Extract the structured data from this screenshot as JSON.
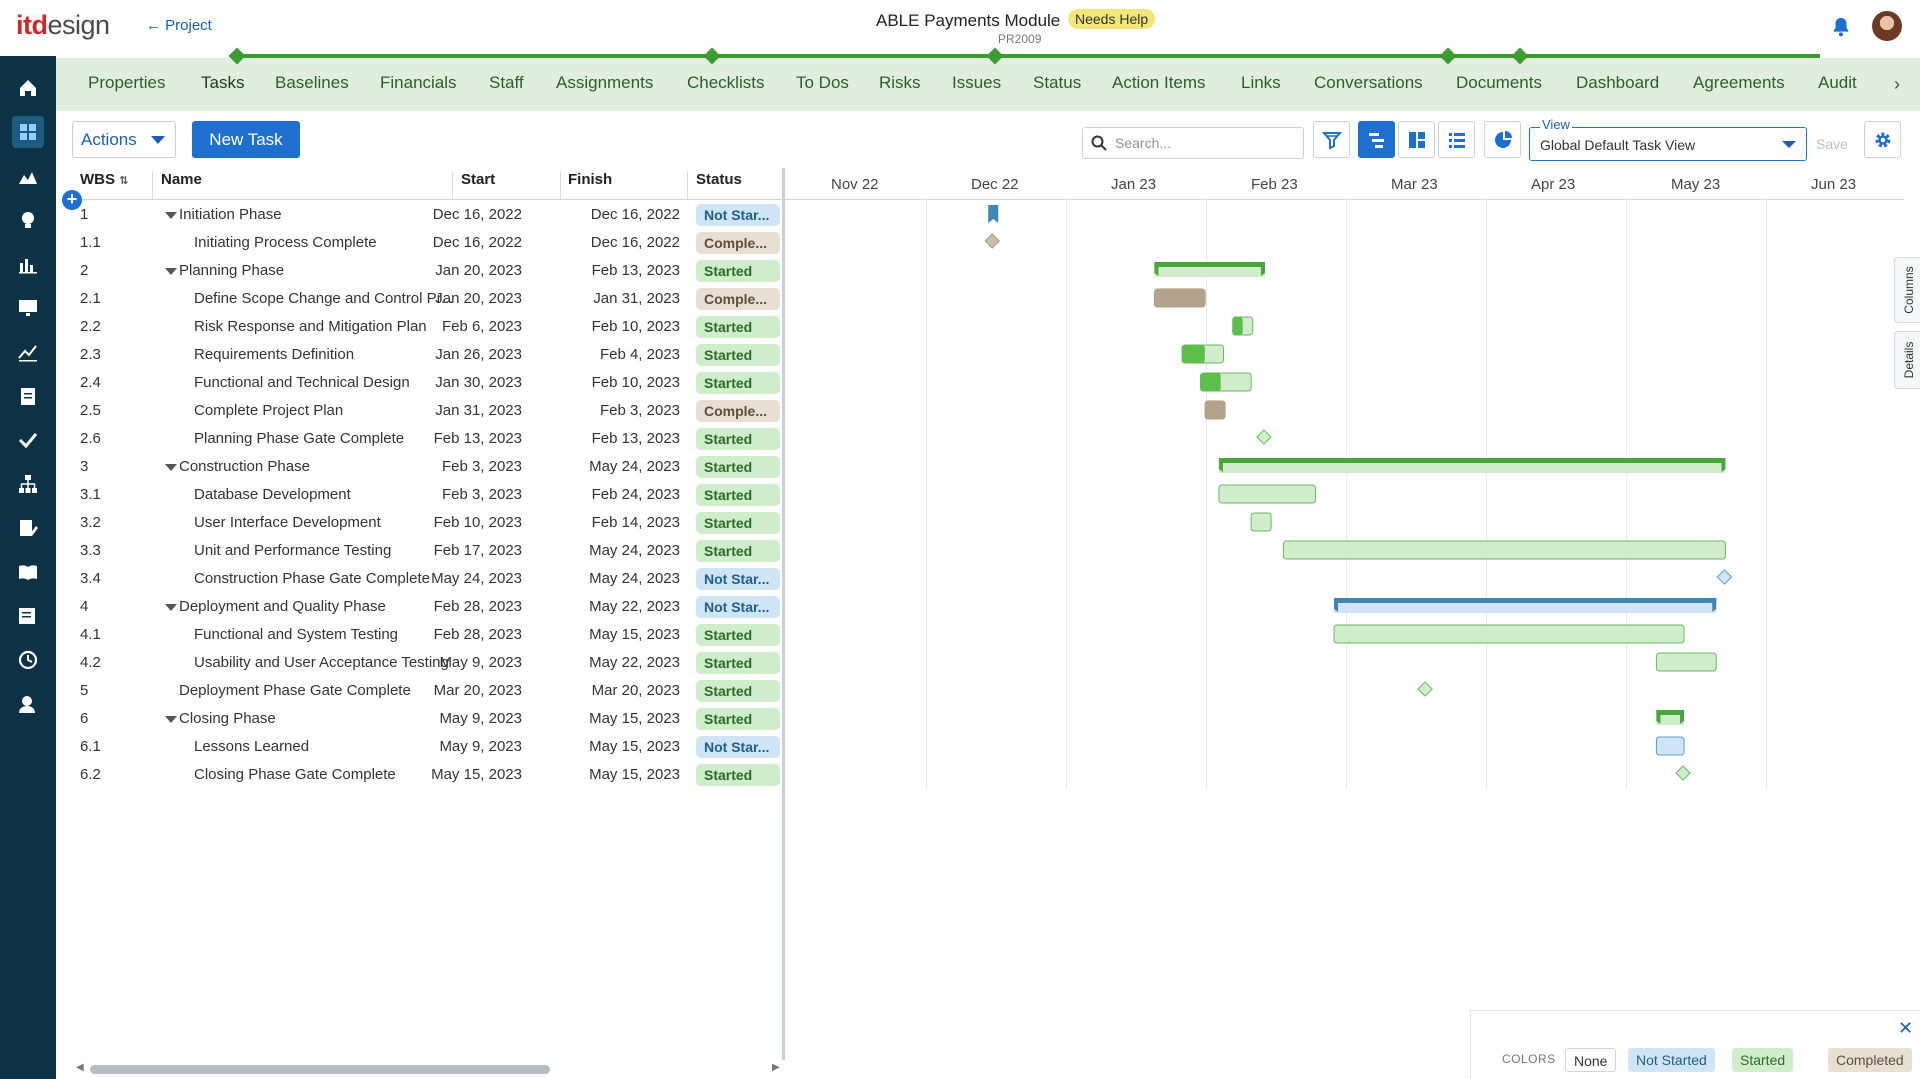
{
  "header": {
    "logo_a": "itd",
    "logo_b": "esign",
    "back_label": "← Project",
    "project_title": "ABLE Payments Module",
    "project_badge": "Needs Help",
    "project_code": "PR2009"
  },
  "sidebar": {
    "items": [
      "home-icon",
      "grid-icon",
      "chart-area-icon",
      "lightbulb-icon",
      "bar-chart-icon",
      "monitor-icon",
      "line-chart-icon",
      "clipboard-icon",
      "check-icon",
      "org-chart-icon",
      "document-edit-icon",
      "book-icon",
      "list-edit-icon",
      "clock-icon",
      "user-gear-icon"
    ]
  },
  "tabs": [
    "Properties",
    "Tasks",
    "Baselines",
    "Financials",
    "Staff",
    "Assignments",
    "Checklists",
    "To Dos",
    "Risks",
    "Issues",
    "Status",
    "Action Items",
    "Links",
    "Conversations",
    "Documents",
    "Dashboard",
    "Agreements",
    "Audit"
  ],
  "active_tab": "Tasks",
  "toolbar": {
    "actions_label": "Actions",
    "new_task_label": "New Task",
    "search_placeholder": "Search...",
    "view_label": "View",
    "view_value": "Global Default Task View",
    "save_label": "Save"
  },
  "columns": {
    "wbs": "WBS",
    "name": "Name",
    "start": "Start",
    "finish": "Finish",
    "status": "Status"
  },
  "months": [
    "Nov 22",
    "Dec 22",
    "Jan 23",
    "Feb 23",
    "Mar 23",
    "Apr 23",
    "May 23",
    "Jun 23"
  ],
  "tasks": [
    {
      "wbs": "1",
      "name": "Initiation Phase",
      "level": 0,
      "toggle": true,
      "start": "Dec 16, 2022",
      "finish": "Dec 16, 2022",
      "status": "Not Star...",
      "status_type": "notstarted"
    },
    {
      "wbs": "1.1",
      "name": "Initiating Process Complete",
      "level": 1,
      "toggle": false,
      "start": "Dec 16, 2022",
      "finish": "Dec 16, 2022",
      "status": "Comple...",
      "status_type": "completed"
    },
    {
      "wbs": "2",
      "name": "Planning Phase",
      "level": 0,
      "toggle": true,
      "start": "Jan 20, 2023",
      "finish": "Feb 13, 2023",
      "status": "Started",
      "status_type": "started"
    },
    {
      "wbs": "2.1",
      "name": "Define Scope Change and Control Pr...",
      "level": 1,
      "toggle": false,
      "start": "Jan 20, 2023",
      "finish": "Jan 31, 2023",
      "status": "Comple...",
      "status_type": "completed"
    },
    {
      "wbs": "2.2",
      "name": "Risk Response and Mitigation Plan",
      "level": 1,
      "toggle": false,
      "start": "Feb 6, 2023",
      "finish": "Feb 10, 2023",
      "status": "Started",
      "status_type": "started"
    },
    {
      "wbs": "2.3",
      "name": "Requirements Definition",
      "level": 1,
      "toggle": false,
      "start": "Jan 26, 2023",
      "finish": "Feb 4, 2023",
      "status": "Started",
      "status_type": "started"
    },
    {
      "wbs": "2.4",
      "name": "Functional and Technical Design",
      "level": 1,
      "toggle": false,
      "start": "Jan 30, 2023",
      "finish": "Feb 10, 2023",
      "status": "Started",
      "status_type": "started"
    },
    {
      "wbs": "2.5",
      "name": "Complete Project Plan",
      "level": 1,
      "toggle": false,
      "start": "Jan 31, 2023",
      "finish": "Feb 3, 2023",
      "status": "Comple...",
      "status_type": "completed"
    },
    {
      "wbs": "2.6",
      "name": "Planning Phase Gate Complete",
      "level": 1,
      "toggle": false,
      "start": "Feb 13, 2023",
      "finish": "Feb 13, 2023",
      "status": "Started",
      "status_type": "started"
    },
    {
      "wbs": "3",
      "name": "Construction Phase",
      "level": 0,
      "toggle": true,
      "start": "Feb 3, 2023",
      "finish": "May 24, 2023",
      "status": "Started",
      "status_type": "started"
    },
    {
      "wbs": "3.1",
      "name": "Database Development",
      "level": 1,
      "toggle": false,
      "start": "Feb 3, 2023",
      "finish": "Feb 24, 2023",
      "status": "Started",
      "status_type": "started"
    },
    {
      "wbs": "3.2",
      "name": "User Interface Development",
      "level": 1,
      "toggle": false,
      "start": "Feb 10, 2023",
      "finish": "Feb 14, 2023",
      "status": "Started",
      "status_type": "started"
    },
    {
      "wbs": "3.3",
      "name": "Unit and Performance Testing",
      "level": 1,
      "toggle": false,
      "start": "Feb 17, 2023",
      "finish": "May 24, 2023",
      "status": "Started",
      "status_type": "started"
    },
    {
      "wbs": "3.4",
      "name": "Construction Phase Gate Complete",
      "level": 1,
      "toggle": false,
      "start": "May 24, 2023",
      "finish": "May 24, 2023",
      "status": "Not Star...",
      "status_type": "notstarted"
    },
    {
      "wbs": "4",
      "name": "Deployment and Quality Phase",
      "level": 0,
      "toggle": true,
      "start": "Feb 28, 2023",
      "finish": "May 22, 2023",
      "status": "Not Star...",
      "status_type": "notstarted"
    },
    {
      "wbs": "4.1",
      "name": "Functional and System Testing",
      "level": 1,
      "toggle": false,
      "start": "Feb 28, 2023",
      "finish": "May 15, 2023",
      "status": "Started",
      "status_type": "started"
    },
    {
      "wbs": "4.2",
      "name": "Usability and User Acceptance Testing",
      "level": 1,
      "toggle": false,
      "start": "May 9, 2023",
      "finish": "May 22, 2023",
      "status": "Started",
      "status_type": "started"
    },
    {
      "wbs": "5",
      "name": "Deployment Phase Gate Complete",
      "level": 0,
      "toggle": false,
      "start": "Mar 20, 2023",
      "finish": "Mar 20, 2023",
      "status": "Started",
      "status_type": "started"
    },
    {
      "wbs": "6",
      "name": "Closing Phase",
      "level": 0,
      "toggle": true,
      "start": "May 9, 2023",
      "finish": "May 15, 2023",
      "status": "Started",
      "status_type": "started"
    },
    {
      "wbs": "6.1",
      "name": "Lessons Learned",
      "level": 1,
      "toggle": false,
      "start": "May 9, 2023",
      "finish": "May 15, 2023",
      "status": "Not Star...",
      "status_type": "notstarted"
    },
    {
      "wbs": "6.2",
      "name": "Closing Phase Gate Complete",
      "level": 1,
      "toggle": false,
      "start": "May 15, 2023",
      "finish": "May 15, 2023",
      "status": "Started",
      "status_type": "started"
    }
  ],
  "gantt_bars": [
    {
      "row": 0,
      "kind": "flag",
      "start": "2022-12-16",
      "finish": "2022-12-16",
      "status_type": "notstarted"
    },
    {
      "row": 1,
      "kind": "milestone",
      "start": "2022-12-16",
      "finish": "2022-12-16",
      "status_type": "completed"
    },
    {
      "row": 2,
      "kind": "summary",
      "start": "2023-01-20",
      "finish": "2023-02-13",
      "status_type": "started"
    },
    {
      "row": 3,
      "kind": "task",
      "start": "2023-01-20",
      "finish": "2023-01-31",
      "status_type": "completed",
      "progress": 1.0
    },
    {
      "row": 4,
      "kind": "task",
      "start": "2023-02-06",
      "finish": "2023-02-10",
      "status_type": "started",
      "progress": 0.5
    },
    {
      "row": 5,
      "kind": "task",
      "start": "2023-01-26",
      "finish": "2023-02-04",
      "status_type": "started",
      "progress": 0.55
    },
    {
      "row": 6,
      "kind": "task",
      "start": "2023-01-30",
      "finish": "2023-02-10",
      "status_type": "started",
      "progress": 0.4
    },
    {
      "row": 7,
      "kind": "task",
      "start": "2023-01-31",
      "finish": "2023-02-03",
      "status_type": "completed",
      "progress": 1.0
    },
    {
      "row": 8,
      "kind": "milestone",
      "start": "2023-02-13",
      "finish": "2023-02-13",
      "status_type": "started"
    },
    {
      "row": 9,
      "kind": "summary",
      "start": "2023-02-03",
      "finish": "2023-05-24",
      "status_type": "started"
    },
    {
      "row": 10,
      "kind": "task",
      "start": "2023-02-03",
      "finish": "2023-02-24",
      "status_type": "started",
      "progress": 0.0
    },
    {
      "row": 11,
      "kind": "task",
      "start": "2023-02-10",
      "finish": "2023-02-14",
      "status_type": "started",
      "progress": 0.0
    },
    {
      "row": 12,
      "kind": "task",
      "start": "2023-02-17",
      "finish": "2023-05-24",
      "status_type": "started",
      "progress": 0.0
    },
    {
      "row": 13,
      "kind": "milestone",
      "start": "2023-05-24",
      "finish": "2023-05-24",
      "status_type": "notstarted"
    },
    {
      "row": 14,
      "kind": "summary",
      "start": "2023-02-28",
      "finish": "2023-05-22",
      "status_type": "notstarted"
    },
    {
      "row": 15,
      "kind": "task",
      "start": "2023-02-28",
      "finish": "2023-05-15",
      "status_type": "started",
      "progress": 0.0
    },
    {
      "row": 16,
      "kind": "task",
      "start": "2023-05-09",
      "finish": "2023-05-22",
      "status_type": "started",
      "progress": 0.0
    },
    {
      "row": 17,
      "kind": "milestone",
      "start": "2023-03-20",
      "finish": "2023-03-20",
      "status_type": "started"
    },
    {
      "row": 18,
      "kind": "summary",
      "start": "2023-05-09",
      "finish": "2023-05-15",
      "status_type": "started"
    },
    {
      "row": 19,
      "kind": "task",
      "start": "2023-05-09",
      "finish": "2023-05-15",
      "status_type": "notstarted",
      "progress": 0.0
    },
    {
      "row": 20,
      "kind": "milestone",
      "start": "2023-05-15",
      "finish": "2023-05-15",
      "status_type": "started"
    }
  ],
  "side_tabs": [
    "Columns",
    "Details"
  ],
  "legend": {
    "title": "COLORS",
    "items": [
      {
        "label": "None",
        "type": "none"
      },
      {
        "label": "Not Started",
        "type": "notstarted"
      },
      {
        "label": "Started",
        "type": "started"
      },
      {
        "label": "Completed",
        "type": "completed"
      }
    ]
  },
  "colors": {
    "brand_red": "#c62a2a",
    "sidebar_bg": "#0d3246",
    "accent_blue": "#1f6fce",
    "tab_bar_bg": "#dfeedd",
    "rail_green": "#3c9a32",
    "started_fill": "#cfeccb",
    "started_dark": "#5cbf4c",
    "notstarted_fill": "#cfe4f4",
    "notstarted_dark": "#4a8fc0",
    "completed_fill": "#c9bca9",
    "completed_dark": "#b3a38c"
  }
}
